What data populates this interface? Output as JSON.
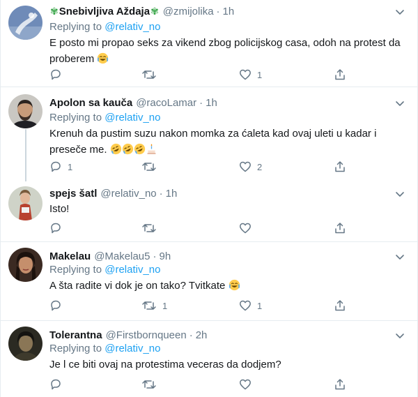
{
  "colors": {
    "link": "#1da1f2",
    "muted": "#657786",
    "text": "#14171a",
    "border": "#e6ecf0",
    "emblem": "#3aa64a"
  },
  "reply_label": "Replying to",
  "tweets": [
    {
      "name": "Snebivljiva Aždaja",
      "handle": "@zmijolika",
      "time": "1h",
      "replying_to": "@relativ_no",
      "text": "E posto mi propao seks za vikend zbog policijskog casa, odoh na protest da proberem",
      "emojis": [
        "joy"
      ],
      "reply_count": "",
      "retweet_count": "",
      "like_count": "1"
    },
    {
      "name": "Apolon sa kauča",
      "handle": "@racoLamar",
      "time": "1h",
      "replying_to": "@relativ_no",
      "text": "Krenuh da pustim suzu nakon momka za ćaleta kad ovaj uleti u kadar i preseče me.",
      "emojis": [
        "rofl",
        "rofl",
        "rofl",
        "cake"
      ],
      "reply_count": "1",
      "retweet_count": "",
      "like_count": "2"
    },
    {
      "name": "spejs šatl",
      "handle": "@relativ_no",
      "time": "1h",
      "replying_to": "",
      "text": "Isto!",
      "emojis": [],
      "reply_count": "",
      "retweet_count": "",
      "like_count": ""
    },
    {
      "name": "Makelau",
      "handle": "@Makelau5",
      "time": "9h",
      "replying_to": "@relativ_no",
      "text": "A šta radite vi dok je on tako? Tvitkate",
      "emojis": [
        "joy"
      ],
      "reply_count": "",
      "retweet_count": "1",
      "like_count": "1"
    },
    {
      "name": "Tolerantna",
      "handle": "@Firstbornqueen",
      "time": "2h",
      "replying_to": "@relativ_no",
      "text": "Je l ce biti ovaj na protestima veceras da dodjem?",
      "emojis": [],
      "reply_count": "",
      "retweet_count": "",
      "like_count": ""
    }
  ]
}
